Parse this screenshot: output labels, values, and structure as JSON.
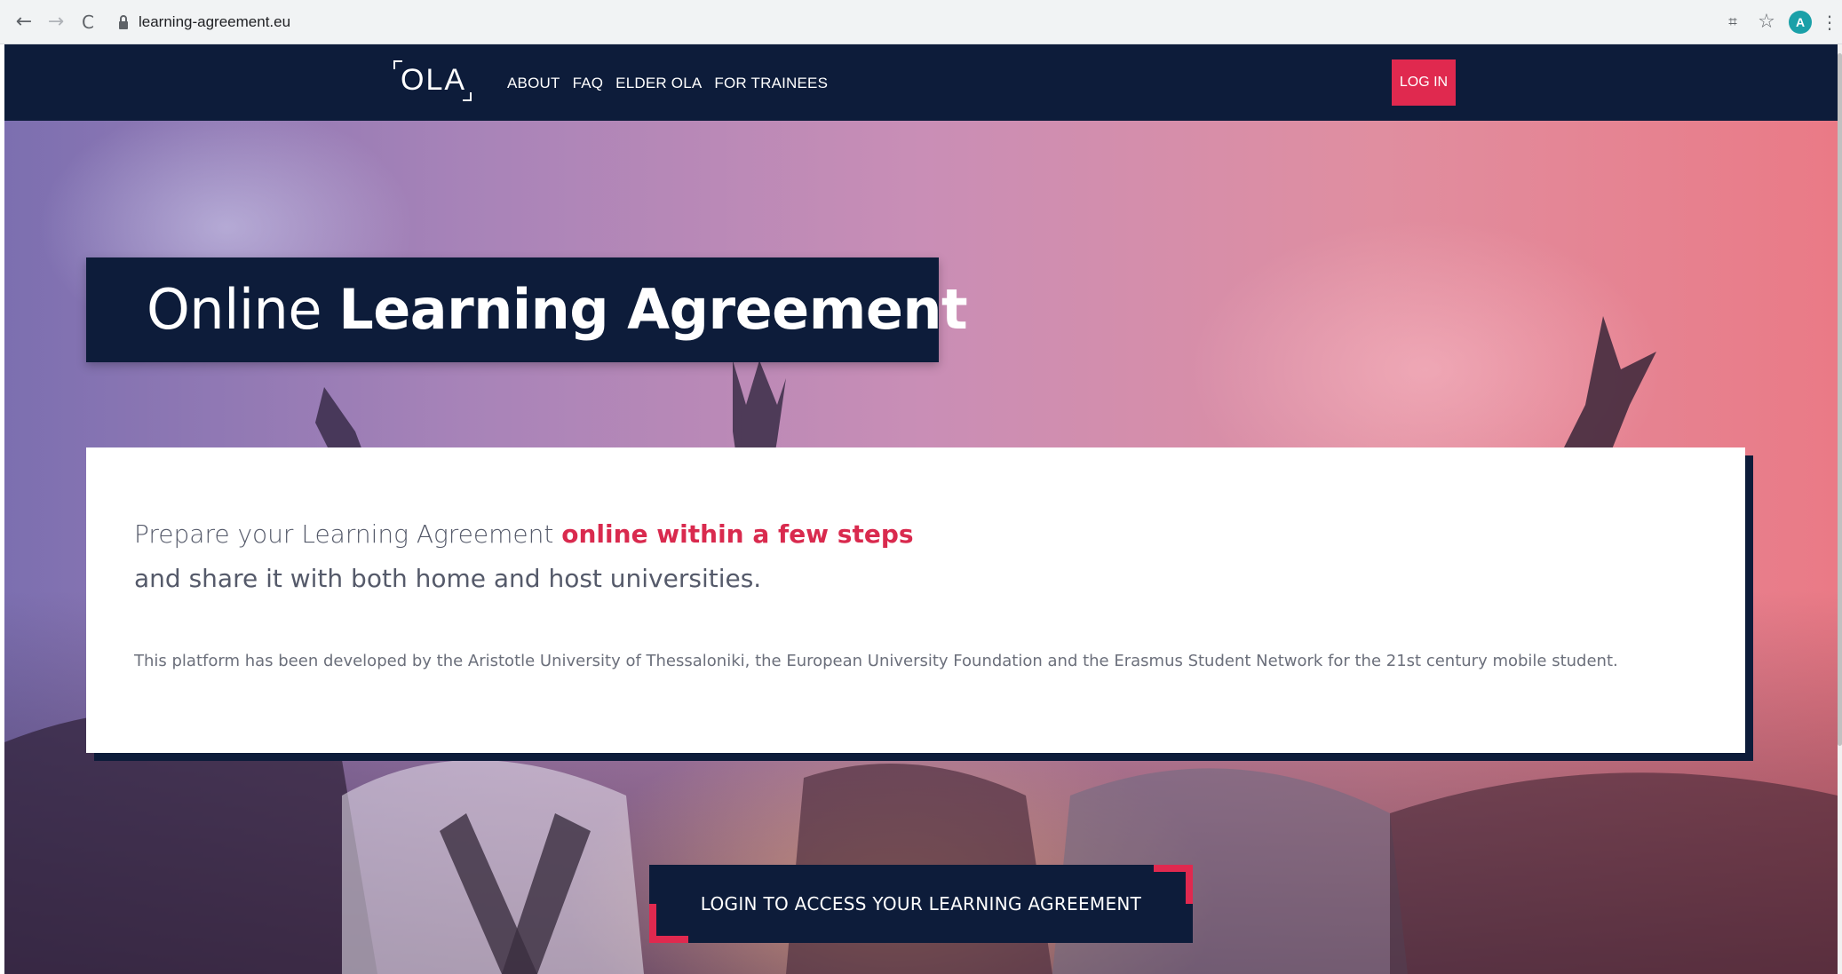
{
  "browser": {
    "url": "learning-agreement.eu",
    "back_glyph": "←",
    "forward_glyph": "→",
    "reload_glyph": "C",
    "translate_glyph": "⌗",
    "star_glyph": "☆",
    "avatar_letter": "A",
    "menu_glyph": "⋮",
    "icons": [
      "back-arrow-icon",
      "forward-arrow-icon",
      "reload-icon",
      "lock-icon",
      "translate-icon",
      "star-icon",
      "avatar",
      "kebab-menu-icon"
    ]
  },
  "header": {
    "logo_text": "OLA",
    "nav": [
      {
        "label": "ABOUT"
      },
      {
        "label": "FAQ"
      },
      {
        "label": "ELDER OLA"
      },
      {
        "label": "FOR TRAINEES"
      }
    ],
    "login_label": "LOG IN"
  },
  "hero": {
    "title_light": "Online",
    "title_bold": "Learning Agreement",
    "lead_prefix": "Prepare your Learning Agreement",
    "lead_highlight": "online within a few steps",
    "lead_line2": "and share it with both home and host universities.",
    "description": "This platform has been developed by the Aristotle University of Thessaloniki, the European University Foundation and the Erasmus Student Network for the 21st century mobile student.",
    "cta_label": "LOGIN TO ACCESS YOUR LEARNING AGREEMENT"
  },
  "colors": {
    "navy": "#0d1c3a",
    "accent_red": "#e0294f",
    "highlight_red": "#d92a4e",
    "chrome_bg": "#f1f3f4"
  }
}
